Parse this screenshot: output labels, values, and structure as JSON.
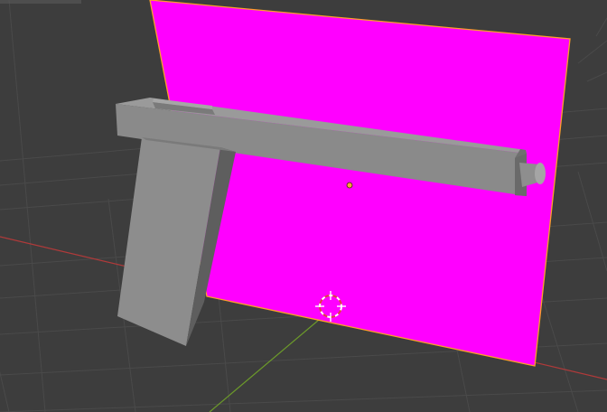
{
  "viewport": {
    "background_color": "#3d3d3d",
    "grid_color": "#4a4a4a",
    "grid_major_color": "#525252",
    "x_axis_color": "#b03a3a",
    "y_axis_color": "#6c9a2a",
    "z_axis_color": "#3d5a7a"
  },
  "objects": {
    "plane": {
      "name_icon": "plane-mesh",
      "fill_color": "#ff00ff",
      "outline_color": "#ff9f2a",
      "selected": true
    },
    "gun": {
      "name_icon": "gun-mesh",
      "light_color": "#9a9a9a",
      "mid_color": "#858585",
      "dark_color": "#5e5e5e",
      "selected": false
    }
  },
  "overlays": {
    "origin_dot_color": "#f7a23a",
    "cursor_color": "#ffffff",
    "cursor_accent_color": "#e04040",
    "cursor_icon": "3d-cursor-icon"
  }
}
